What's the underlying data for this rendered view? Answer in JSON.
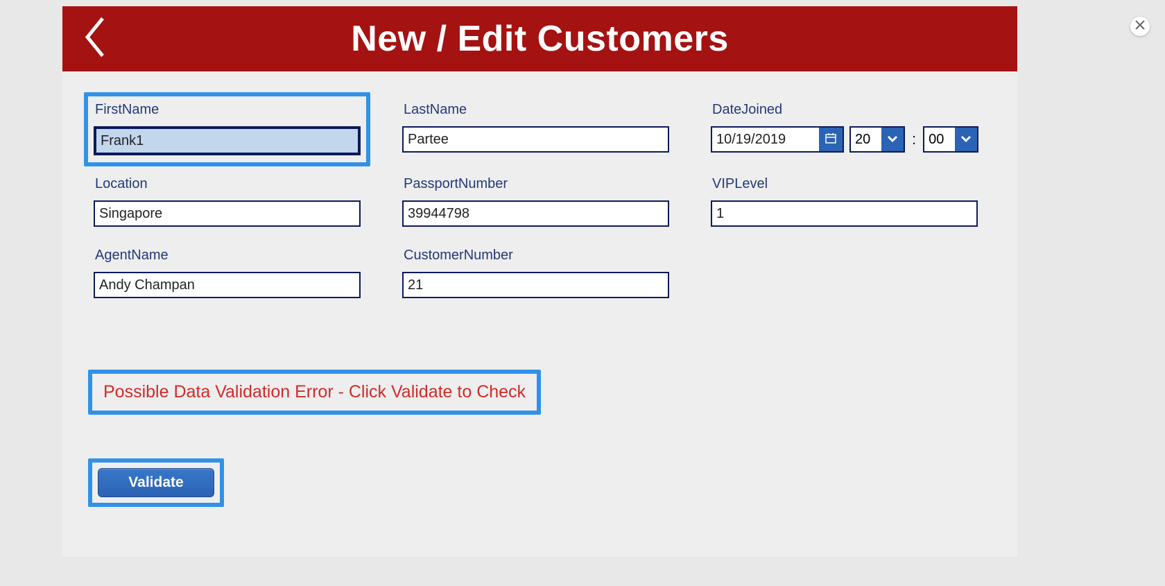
{
  "header": {
    "title": "New / Edit Customers"
  },
  "form": {
    "firstName": {
      "label": "FirstName",
      "value": "Frank1"
    },
    "lastName": {
      "label": "LastName",
      "value": "Partee"
    },
    "dateJoined": {
      "label": "DateJoined",
      "date": "10/19/2019",
      "hour": "20",
      "minute": "00",
      "separator": ":"
    },
    "location": {
      "label": "Location",
      "value": "Singapore"
    },
    "passport": {
      "label": "PassportNumber",
      "value": "39944798"
    },
    "vipLevel": {
      "label": "VIPLevel",
      "value": "1"
    },
    "agentName": {
      "label": "AgentName",
      "value": "Andy Champan"
    },
    "customerNumber": {
      "label": "CustomerNumber",
      "value": "21"
    }
  },
  "validation": {
    "message": "Possible Data Validation Error - Click Validate to Check",
    "button": "Validate"
  }
}
